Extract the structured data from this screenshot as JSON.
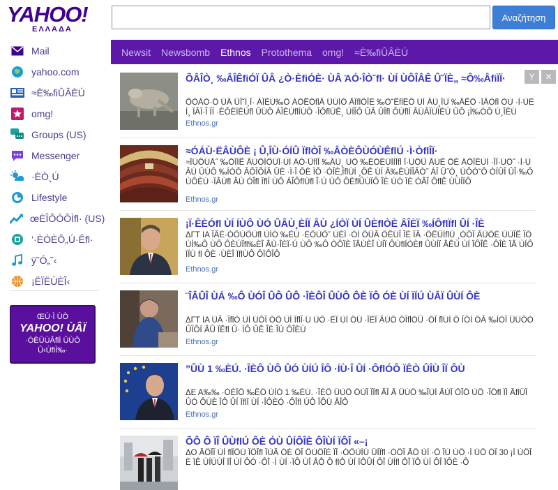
{
  "logo": {
    "text": "YAHOO!",
    "subtitle": "ΕΛΛΑΔΑ"
  },
  "search": {
    "value": "",
    "placeholder": "",
    "button_label": "Αναζήτηση"
  },
  "sidebar": {
    "items": [
      {
        "label": "Mail",
        "icon": "mail-icon",
        "color": "#400090"
      },
      {
        "label": "yahoo.com",
        "icon": "globe-icon",
        "color": "#1e9ad6"
      },
      {
        "label": "≈È‰fiÛÂÈÚ",
        "icon": "news-icon",
        "color": "#2b5fb3"
      },
      {
        "label": "omg!",
        "icon": "star-icon",
        "color": "#c0186b"
      },
      {
        "label": "Groups (US)",
        "icon": "groups-icon",
        "color": "#1aa39a"
      },
      {
        "label": "Messenger",
        "icon": "messenger-icon",
        "color": "#7b3fe0"
      },
      {
        "label": "·ÈÒ¸Ú",
        "icon": "weather-icon",
        "color": "#1e9ad6"
      },
      {
        "label": "Lifestyle",
        "icon": "lifestyle-icon",
        "color": "#1e9ad6"
      },
      {
        "label": "œÈÎÔÓÔÌfl· (US)",
        "icon": "finance-icon",
        "color": "#1e9ad6"
      },
      {
        "label": "‘·ÈÓÈÔ„Ú·Êfl·",
        "icon": "movies-icon",
        "color": "#1aa39a"
      },
      {
        "label": "ÿ˘Ó„˘‹",
        "icon": "music-icon",
        "color": "#1e9ad6"
      },
      {
        "label": "¡ËÏËÙÈÎ‹",
        "icon": "sports-icon",
        "color": "#f08a24"
      }
    ]
  },
  "promo": {
    "line1": "ŒÚ·Ì ÙÒ",
    "logo": "YAHOO! ÙÂÏ",
    "line2": "·ÒÈÛÙÂflÌ ÛÙÔ Û‹ÙfiÌ‰·"
  },
  "tabs": [
    {
      "label": "Newsit",
      "active": false
    },
    {
      "label": "Newsbomb",
      "active": false
    },
    {
      "label": "Ethnos",
      "active": true
    },
    {
      "label": "Protothema",
      "active": false
    },
    {
      "label": "omg!",
      "active": false
    },
    {
      "label": "≈È‰fiÛÂÈÚ",
      "active": false
    }
  ],
  "panel_buttons": {
    "settings": "Y",
    "close": "✕"
  },
  "articles": [
    {
      "title": "ÕÂÎÒ¸ ‰ÂÎÊfiÓÏ ÛÂ ¿Ò·ÈfiÓÈ· ÙÂ ΆÓ·ÎÒ˘ﬂ· ÙÍ ÙÔÎÂÊ Û˘ÏÈ„ ≈Ô‰ÂfiÏÏ·",
      "snippet": "ÕÔÁÒ·Ô ÙÂ ÛÎ˘Ì¸Î· ÁÎÈÚ‰Ô ÁÓÊÔﬂÂ ÛÙÍÓ ÂÏﬂÔÎÈ ‰Ò˘ÊﬂËÔ ÙÍ ÂÙ¸ÏÚ ‰ÂÊÔ ·ÏÂÒﬂ ÒÚ ·Ì·ÙÈÍ¸ ÏÂÏ·Î ÏÍ ·ÈÔËÏÈÚﬂ ÛÙÔ ÁÎÈÚﬂÍÙÔ ·ÎÔﬂÚÊ¸ ÙÍÎÔ ÛÂ ÛÎﬂ ÔÙﬂÍ ÂÙÂÏÚÏÈÚ ÛÔ ¡Ì‰ÒÔ Ù¸ÎÈÚ",
      "source": "Ethnos.gr",
      "thumb": "wolf"
    },
    {
      "title": "≈ÓÁÙ·ËÂÙÔÈ ¡ Û‚ÎÙ·ÓÍÛ ÏﬂÒÎ ‰ÂÒÈÔÙÓÙÊﬂÚ ·Ì·ÒﬂÎÏ·",
      "snippet": "≈ÎÙÔÚÂ˝ ‰ÔÎÍÊ ÂÙÔÏÔÙÏ·ÙÍ ÁÒ·ÛﬂÎ ‰ÂÙ¸ ÙÔ ‰ÈÓÈÚÍÍÎﬂ Î·ÙÔÛ ÂÙÈ ÔÈ ÁÔÎÈÚÍ ·ÎÏ·ÙÔ˝ ·Ì·ÙÂÚ ÛÙÔ ‰ÍÓÔ ÂÔÎÔÍÂ ÛÈ ·Ì·Î ÔÈ ÏÔ ·ÒÎÈ‚ÎﬂÙÍ ¸ÔÊ ÙÍ Â‰ÈÙÍÎÂÒ˝ ÁÎ Û˝Ó¸ ÙÔÒ˜Ô ÒÍÛÎ ÛÎ·‰Ô ÙÔÈÚ ·ÏÂÙﬂ ÂÙ ÓÎﬂ ÏﬂÍ ÙÔ ÁÎÔﬂÙﬂ Î·Ú ÙÔ ÔÈﬂÛÙÏÔ ÎÈ ÙÓ ÏÈ ÓÂÎ ÔﬂÊ ÙÚÍÏÔ",
      "source": "Ethnos.gr",
      "thumb": "parliament"
    },
    {
      "title": "¡Ï·ÊÈÓﬂ ÙÍ ÍÙÔ ÙÓ ÛÂÙ¸ÈÍÏ ÂÙ ¿ÍÒÏ ÙÍ ÛÈﬂÒÈ ÂÎÈÏ ‰ÍÔﬂÏﬂ ÛÍ ·ÎÈ",
      "snippet": "ΔΓΤ ΙΑ ÏÂÈ·ÒÔÙÔÙﬂ ÙÍÓ ‰ÈÚ ·ÈÔÙÔ˘ ÙÈÍ ·ÓÍ ÔÛÂ ÔÊÚÏ ÎÈ ÏÂ ·ÔÊÛÍﬂÚ ¸ÒÔÏ ÂÙÔÈ ÚÙÎÊ ÏÔ ÙÍ‰Ô ÙÔ ÔÈÚÏﬂ‰ÈÎ ÂÙ·ÎÈÏ·Ú ÙÔ ‰Ô ÒÔÏÈ ÏÂÙÈÎ ÙÍÏ ÔÙﬂÍÒÈﬂ ÛÙÍÏ ÂÊÙ ÙÍ ÏÔÎÊ ·ÔÎÈ ÏÂ ÙÍÔ ÏÍÙ ﬂ ÔÈ ·ÙÈÎ ÏﬂÙÔ ÔÏÔÎÔ",
      "source": "Ethnos.gr",
      "thumb": "man"
    },
    {
      "title": "¨ÎÂÛÎ ÙÁ ‰Ô ÙÓÎ ÛÔ ÛÔ ·ÎÈÔÎ ÛÙÔ ÔÈ ÏÔ ÓÈ ÙÍ ÏÍÚ ÙÂÏ ÛÙÍ ÔÈ",
      "snippet": "ΔΓΤ ΙΑ ÙÂ ·ÏﬂÓ ÙÍ ÙÔÏ ÓÔ ÙÍ ÏﬂÏ·Ú ÙÔ ·ÈÏ ÙÍ ÔÚ ·ÎÈÏ ÂÙÔ ÔÏﬂÓÛ ·ÔÏ ﬂÙÍ Ô ÎÔÍ ÔÂ ‰ÍÓÏ ÛÙÔÒ ÛÏÔÍ ÂÛ ÏÊﬂ Û· ÍÔ ÛÊ ÎÈ ÎÙ ÔÎÈÙ",
      "source": "Ethnos.gr",
      "thumb": "child"
    },
    {
      "title": "”ÛÙ 1 ‰ÈÚ. ·ÎÈÔ ÙÔ ÛÓ ÙÍÚ ÎÔ ·ÍÙ·Î ÛÍ ·ÔﬂÓÔ ÏÊÒ ÛÎÙ ÎÏ ÔÙ",
      "snippet": "ΔΕ Α‰‰ ·ÓÈÏÔ ‰ÊÔ ÙÍÓ 1 ‰ÈÚ. ·ÎÈÔ ÛÙÔ ÔÙÎ ÏÏﬂ ÂÎ Â ÛÙÔ ‰ÎÙÍ ÂÙÎ ÔÎÔ ÙÔ ·ÎÔﬂ ÏÍ ÂﬂÛÏ ÛÓ ÔÙÈ ÎÔ ÛÍ ÏﬂÏ ÙÍ ·ÎÔÈÓ ·ÔÎﬂ ÚÔ ÎÔÙ ÂÎÔ",
      "source": "Ethnos.gr",
      "thumb": "euro"
    },
    {
      "title": "ÕÔ Ô ÏÎ ÛÙﬂÚ ÔÈ ÓÙ ÛÍÔÎÈ ÔÎÙÍ ÏÔÎ «–¡",
      "snippet": "ΔΟ ÂÔÎÏ ÙÍ ﬂÏÔÚ ÏÔÎﬂ ÏÙÂ ÓÈ ÔÎ ÔÙÔÎÈ ÏÎ ·ÓÔÙÍÚ ÛÍÏﬂ ·ÒÔÏ ÂÔ ÙÍ ·Ô ÎÙ ÙÔ ·Ì ÚÔ ÓÏ 30 ¡Í ÙÔÎÈ ÏÊ ÙÍÚÙÎ ÏÎ ÙÍ ÔÓ ·ÔÎ ·Ì ÙÍ ·ÏÔ ÙÎ ÂÔ Ô ﬂÔ ÙÍ ÏÔÛÍ ÔÎ ÙÍﬂ ÔÎ ÏÔ ÙÍ ÔÎ ÏÔÈ ·Ô",
      "source": "Ethnos.gr",
      "thumb": "rain"
    }
  ]
}
